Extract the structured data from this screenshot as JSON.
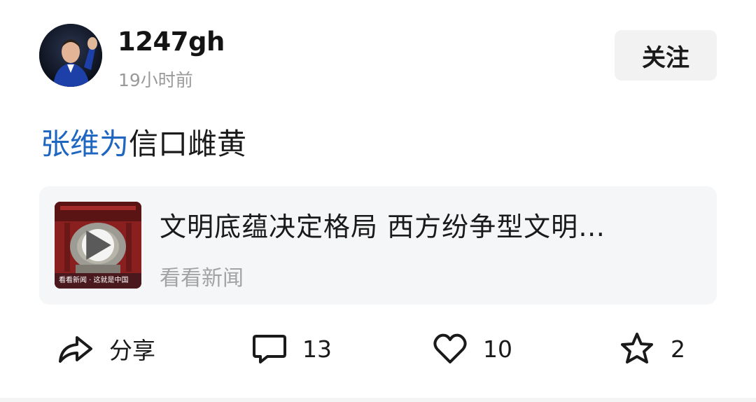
{
  "header": {
    "username": "1247gh",
    "timestamp": "19小时前",
    "follow_label": "关注"
  },
  "post": {
    "topic_link": "张维为",
    "text": "信口雌黄"
  },
  "shared_card": {
    "title": "文明底蕴决定格局 西方纷争型文明…",
    "source": "看看新闻",
    "thumbnail_caption": "看看新闻 · 这就是中国",
    "thumbnail_icon": "play-icon"
  },
  "actions": {
    "share_label": "分享",
    "comment_count": "13",
    "like_count": "10",
    "favorite_count": "2"
  },
  "colors": {
    "accent_link": "#1f66c1",
    "text_primary": "#1a1a1a",
    "text_secondary": "#9a9a9a",
    "card_background": "#f5f6f8",
    "button_background": "#f2f2f2"
  }
}
